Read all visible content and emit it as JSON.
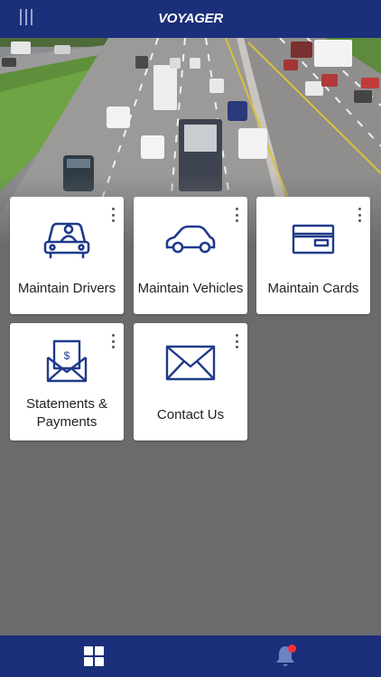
{
  "app": {
    "brand": "VOYAGER"
  },
  "header": {
    "menu_icon": "menu-icon"
  },
  "tiles": [
    {
      "label": "Maintain Drivers",
      "icon": "driver-car-icon"
    },
    {
      "label": "Maintain Vehicles",
      "icon": "car-icon"
    },
    {
      "label": "Maintain Cards",
      "icon": "credit-card-icon"
    },
    {
      "label_line1": "Statements &",
      "label_line2": "Payments",
      "icon": "statement-envelope-icon"
    },
    {
      "label": "Contact Us",
      "icon": "envelope-icon"
    }
  ],
  "bottom_nav": {
    "home_icon": "grid-icon",
    "notifications_icon": "bell-icon",
    "has_notification": true
  },
  "colors": {
    "primary": "#1c2f7a",
    "background": "#6b6b6b",
    "icon_stroke": "#1f3a8a",
    "badge": "#ff2d3a"
  }
}
